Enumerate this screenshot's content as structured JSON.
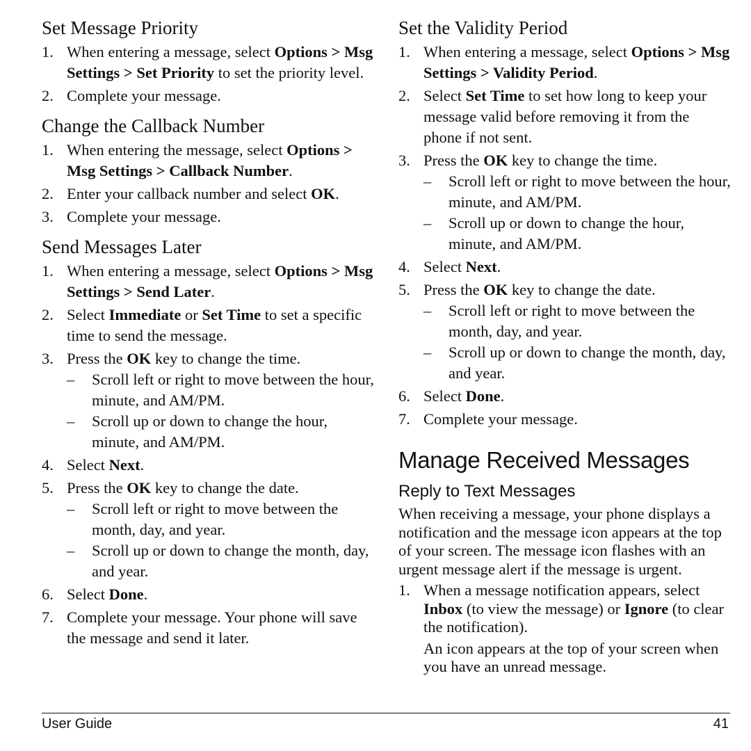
{
  "left_column": {
    "sections": [
      {
        "heading": "Set Message Priority",
        "steps": [
          {
            "num": "1.",
            "segments": [
              {
                "t": "When entering a message, select "
              },
              {
                "t": "Options > Msg Settings > Set Priority",
                "b": true
              },
              {
                "t": " to set the priority level."
              }
            ]
          },
          {
            "num": "2.",
            "segments": [
              {
                "t": "Complete your message."
              }
            ]
          }
        ]
      },
      {
        "heading": "Change the Callback Number",
        "steps": [
          {
            "num": "1.",
            "segments": [
              {
                "t": "When entering the message, select "
              },
              {
                "t": "Options > Msg Settings > Callback Number",
                "b": true
              },
              {
                "t": "."
              }
            ]
          },
          {
            "num": "2.",
            "segments": [
              {
                "t": "Enter your callback number and select "
              },
              {
                "t": "OK",
                "b": true
              },
              {
                "t": "."
              }
            ]
          },
          {
            "num": "3.",
            "segments": [
              {
                "t": "Complete your message."
              }
            ]
          }
        ]
      },
      {
        "heading": "Send Messages Later",
        "steps": [
          {
            "num": "1.",
            "segments": [
              {
                "t": "When entering a message, select "
              },
              {
                "t": "Options > Msg Settings > Send Later",
                "b": true
              },
              {
                "t": "."
              }
            ]
          },
          {
            "num": "2.",
            "segments": [
              {
                "t": "Select "
              },
              {
                "t": "Immediate",
                "b": true
              },
              {
                "t": " or "
              },
              {
                "t": "Set Time",
                "b": true
              },
              {
                "t": " to set a specific time to send the message."
              }
            ]
          },
          {
            "num": "3.",
            "segments": [
              {
                "t": "Press the "
              },
              {
                "t": "OK",
                "b": true
              },
              {
                "t": " key to change the time."
              }
            ],
            "subs": [
              "Scroll left or right to move between the hour, minute, and AM/PM.",
              "Scroll up or down to change the hour, minute, and AM/PM."
            ]
          },
          {
            "num": "4.",
            "segments": [
              {
                "t": "Select "
              },
              {
                "t": "Next",
                "b": true
              },
              {
                "t": "."
              }
            ]
          },
          {
            "num": "5.",
            "segments": [
              {
                "t": "Press the "
              },
              {
                "t": "OK",
                "b": true
              },
              {
                "t": " key to change the date."
              }
            ],
            "subs": [
              "Scroll left or right to move between the month, day, and year.",
              "Scroll up or down to change the month, day, and year."
            ]
          },
          {
            "num": "6.",
            "segments": [
              {
                "t": "Select "
              },
              {
                "t": "Done",
                "b": true
              },
              {
                "t": "."
              }
            ]
          },
          {
            "num": "7.",
            "segments": [
              {
                "t": "Complete your message. Your phone will save the message and send it later."
              }
            ]
          }
        ]
      }
    ]
  },
  "right_column": {
    "sections": [
      {
        "heading": "Set the Validity Period",
        "steps": [
          {
            "num": "1.",
            "segments": [
              {
                "t": "When entering a message, select "
              },
              {
                "t": "Options > Msg Settings > Validity Period",
                "b": true
              },
              {
                "t": "."
              }
            ]
          },
          {
            "num": "2.",
            "segments": [
              {
                "t": "Select "
              },
              {
                "t": "Set Time",
                "b": true
              },
              {
                "t": " to set how long to keep your message valid before removing it from the phone if not sent."
              }
            ]
          },
          {
            "num": "3.",
            "segments": [
              {
                "t": "Press the "
              },
              {
                "t": "OK",
                "b": true
              },
              {
                "t": " key to change the time."
              }
            ],
            "subs": [
              "Scroll left or right to move between the hour, minute, and AM/PM.",
              "Scroll up or down to change the hour, minute, and AM/PM."
            ]
          },
          {
            "num": "4.",
            "segments": [
              {
                "t": "Select "
              },
              {
                "t": "Next",
                "b": true
              },
              {
                "t": "."
              }
            ]
          },
          {
            "num": "5.",
            "segments": [
              {
                "t": "Press the "
              },
              {
                "t": "OK",
                "b": true
              },
              {
                "t": " key to change the date."
              }
            ],
            "subs": [
              "Scroll left or right to move between the month, day, and year.",
              "Scroll up or down to change the month, day, and year."
            ]
          },
          {
            "num": "6.",
            "segments": [
              {
                "t": "Select "
              },
              {
                "t": "Done",
                "b": true
              },
              {
                "t": "."
              }
            ]
          },
          {
            "num": "7.",
            "segments": [
              {
                "t": "Complete your message."
              }
            ]
          }
        ]
      }
    ],
    "chapter_title": "Manage Received Messages",
    "subsection": {
      "heading": "Reply to Text Messages",
      "intro": "When receiving a message, your phone displays a notification and the message icon appears at the top of your screen. The message icon flashes with an urgent message alert if the message is urgent.",
      "steps": [
        {
          "num": "1.",
          "segments": [
            {
              "t": "When a message notification appears, select "
            },
            {
              "t": "Inbox",
              "b": true
            },
            {
              "t": " (to view the message) or "
            },
            {
              "t": "Ignore",
              "b": true
            },
            {
              "t": " (to clear the notification)."
            }
          ],
          "note": "An icon appears at the top of your screen when you have an unread message."
        }
      ]
    }
  },
  "footer": {
    "left": "User Guide",
    "page_number": "41"
  }
}
